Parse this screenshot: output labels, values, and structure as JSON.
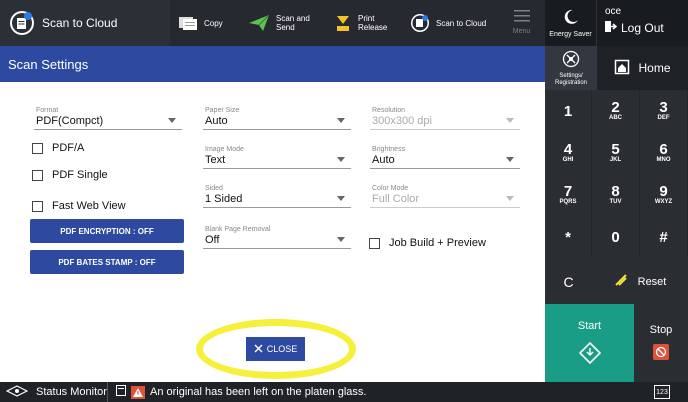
{
  "topbar": {
    "scan_to_cloud": "Scan to Cloud",
    "copy": "Copy",
    "scan_send": "Scan and\nSend",
    "print_release": "Print\nRelease",
    "scan_to_cloud_small": "Scan to Cloud",
    "menu": "Menu"
  },
  "energy": {
    "label": "Energy Saver"
  },
  "user": {
    "name": "oce",
    "logout": "Log Out"
  },
  "panel": {
    "title": "Scan Settings"
  },
  "fields": {
    "format": {
      "label": "Format",
      "value": "PDF(Compct)"
    },
    "paper_size": {
      "label": "Paper Size",
      "value": "Auto"
    },
    "resolution": {
      "label": "Resolution",
      "value": "300x300 dpi"
    },
    "image_mode": {
      "label": "Image Mode",
      "value": "Text"
    },
    "brightness": {
      "label": "Brightness",
      "value": "Auto"
    },
    "sided": {
      "label": "Sided",
      "value": "1 Sided"
    },
    "color_mode": {
      "label": "Color Mode",
      "value": "Full Color"
    },
    "blank_page": {
      "label": "Blank Page Removal",
      "value": "Off"
    }
  },
  "checks": {
    "pdfa": "PDF/A",
    "pdf_single": "PDF Single",
    "fast_web": "Fast Web View",
    "job_build": "Job Build + Preview"
  },
  "buttons": {
    "encryption": "PDF ENCRYPTION : OFF",
    "bates": "PDF BATES STAMP : OFF",
    "close": "CLOSE"
  },
  "status": {
    "monitor": "Status Monitor",
    "message": "An original has been left on the platen glass."
  },
  "right": {
    "settings": "Settings/\nRegistration",
    "home": "Home",
    "reset": "Reset",
    "start": "Start",
    "stop": "Stop",
    "counter": "123"
  },
  "keys": [
    {
      "d": "1",
      "s": ""
    },
    {
      "d": "2",
      "s": "ABC"
    },
    {
      "d": "3",
      "s": "DEF"
    },
    {
      "d": "4",
      "s": "GHI"
    },
    {
      "d": "5",
      "s": "JKL"
    },
    {
      "d": "6",
      "s": "MNO"
    },
    {
      "d": "7",
      "s": "PQRS"
    },
    {
      "d": "8",
      "s": "TUV"
    },
    {
      "d": "9",
      "s": "WXYZ"
    },
    {
      "d": "*",
      "s": ""
    },
    {
      "d": "0",
      "s": ""
    },
    {
      "d": "#",
      "s": ""
    }
  ],
  "colors": {
    "accent": "#2d4aa0",
    "start": "#1a9d86",
    "highlight": "#f6f03c",
    "stop": "#e0513a"
  }
}
